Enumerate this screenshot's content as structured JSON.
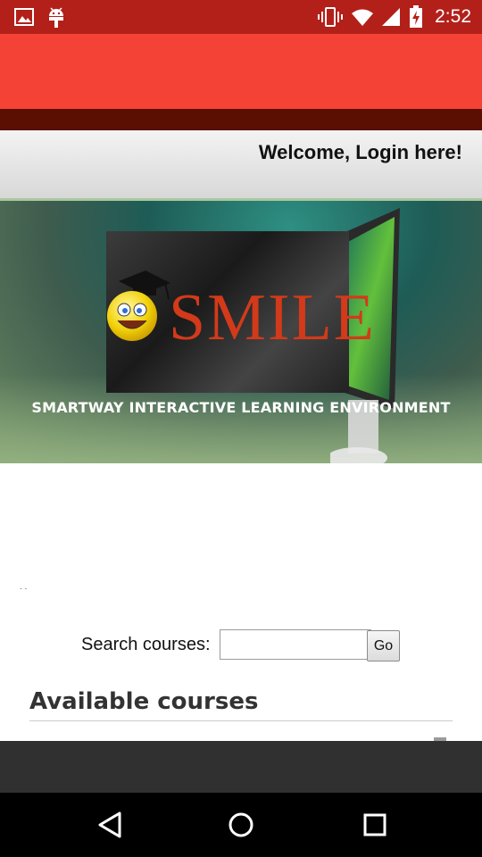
{
  "status_bar": {
    "time": "2:52",
    "left_icons": [
      "image-icon",
      "android-icon"
    ],
    "right_icons": [
      "vibrate-icon",
      "wifi-icon",
      "signal-icon",
      "battery-charging-icon"
    ]
  },
  "header": {
    "welcome_text": "Welcome, Login here!"
  },
  "banner": {
    "logo_text": "SMILE",
    "tagline": "SMARTWAY INTERACTIVE LEARNING ENVIRONMENT"
  },
  "misc": {
    "dots": ". ."
  },
  "search": {
    "label": "Search courses:",
    "value": "",
    "placeholder": "",
    "button_label": "Go"
  },
  "courses": {
    "title": "Available courses"
  },
  "nav_bar": {
    "buttons": [
      "back-icon",
      "home-icon",
      "recents-icon"
    ]
  },
  "colors": {
    "status_bar": "#b3201a",
    "app_bar": "#f44336",
    "dark_band": "#5a0f02",
    "logo_red": "#d23a1a"
  }
}
